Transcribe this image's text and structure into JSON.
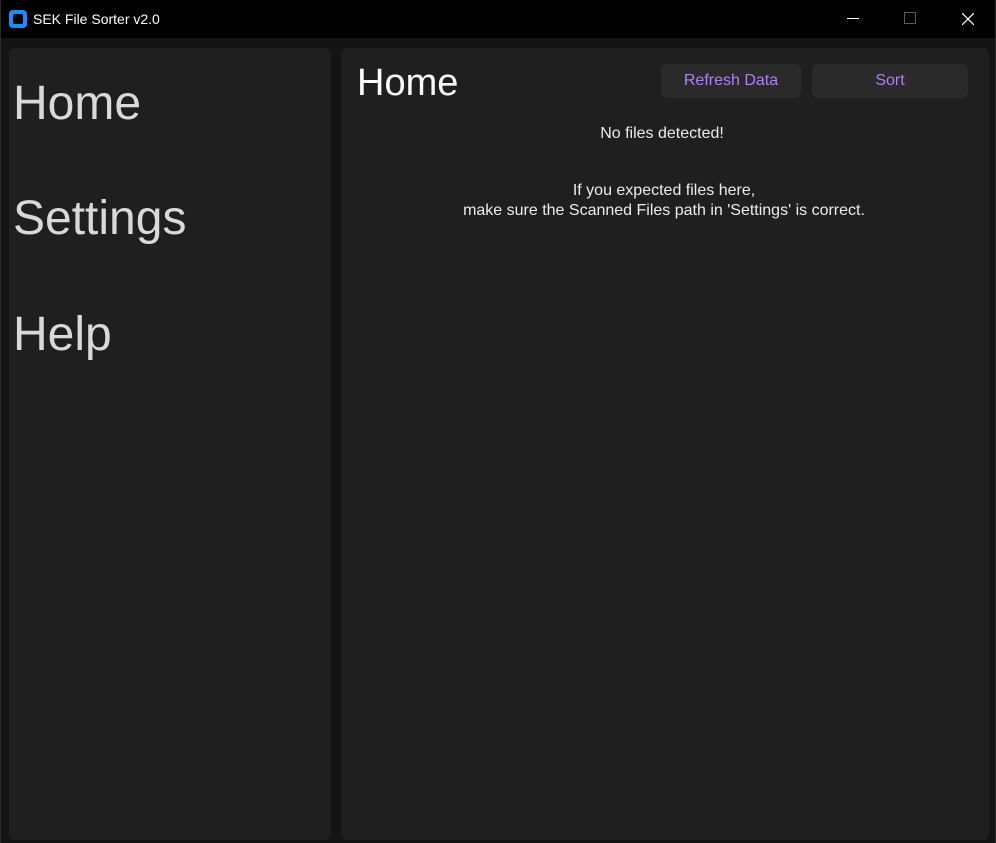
{
  "window": {
    "title": "SEK File Sorter v2.0"
  },
  "sidebar": {
    "items": [
      {
        "label": "Home"
      },
      {
        "label": "Settings"
      },
      {
        "label": "Help"
      }
    ]
  },
  "main": {
    "title": "Home",
    "buttons": {
      "refresh_label": "Refresh Data",
      "sort_label": "Sort"
    },
    "status": "No files detected!",
    "hint_line1": "If you expected files here,",
    "hint_line2": "make sure the Scanned Files path in 'Settings' is correct."
  },
  "colors": {
    "accent": "#b57cff",
    "panel": "#1f1f1f",
    "button_bg": "#2a2a2a",
    "app_icon": "#1a8cff"
  },
  "icons": {
    "app": "app-icon",
    "minimize": "minimize-icon",
    "maximize": "maximize-icon",
    "close": "close-icon"
  }
}
